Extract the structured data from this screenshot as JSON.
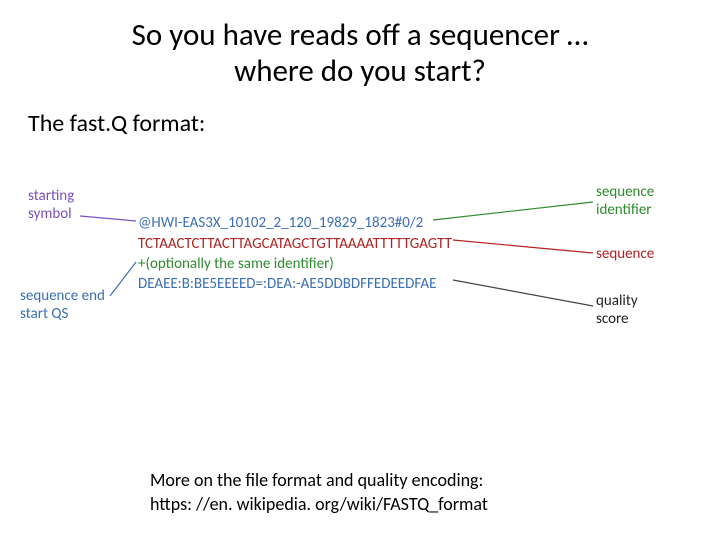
{
  "title_line1": "So you have reads off a sequencer …",
  "title_line2": "where do you start?",
  "subheading": "The fast.Q format:",
  "fastq": {
    "line1": "@HWI-EAS3X_10102_2_120_19829_1823#0/2",
    "line2": "TCTAACTCTTACTTAGCATAGCTGTTAAAATTTTTGAGTT",
    "line3": "+(optionally the same identifier)",
    "line4": "DEAEE:B:BE5EEEED=:DEA:-AE5DDBDFFEDEEDFAE"
  },
  "labels": {
    "starting_symbol_l1": "starting",
    "starting_symbol_l2": "symbol",
    "seq_id_l1": "sequence",
    "seq_id_l2": "identifier",
    "sequence": "sequence",
    "seq_end_l1": "sequence end",
    "seq_end_l2": "start QS",
    "quality_l1": "quality",
    "quality_l2": "score"
  },
  "footer": {
    "line1": "More on the file format and quality encoding:",
    "line2": "https: //en. wikipedia. org/wiki/FASTQ_format"
  }
}
